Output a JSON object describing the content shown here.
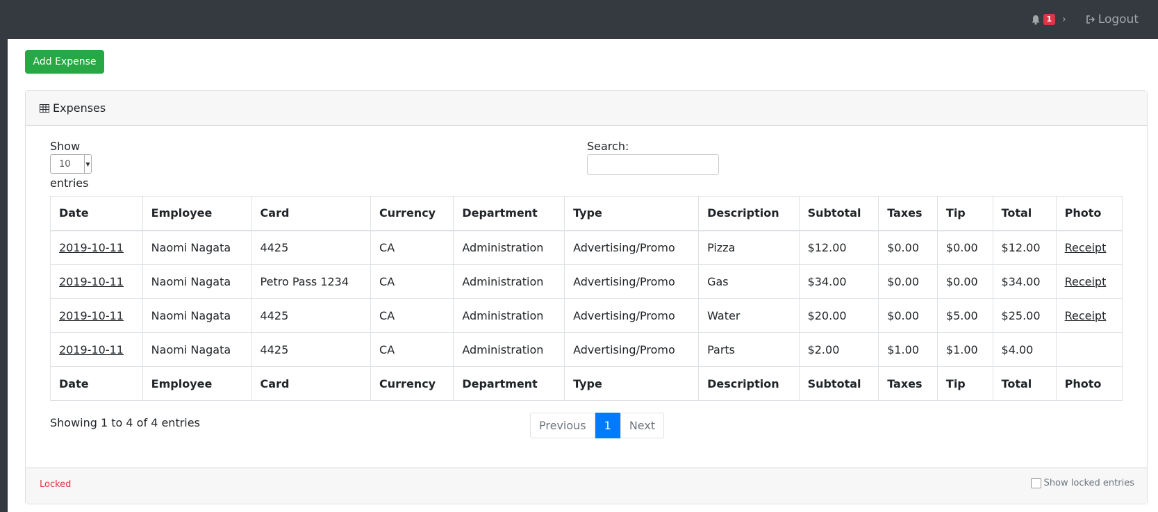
{
  "topbar": {
    "notification_count": "1",
    "logout_label": "Logout"
  },
  "actions": {
    "add_expense_label": "Add Expense"
  },
  "card": {
    "title": "Expenses",
    "length_show_label": "Show",
    "length_value": "10",
    "length_entries_label": "entries",
    "search_label": "Search:",
    "search_value": "",
    "columns": [
      "Date",
      "Employee",
      "Card",
      "Currency",
      "Department",
      "Type",
      "Description",
      "Subtotal",
      "Taxes",
      "Tip",
      "Total",
      "Photo"
    ],
    "rows": [
      [
        "2019-10-11",
        "Naomi Nagata",
        "4425",
        "CA",
        "Administration",
        "Advertising/Promo",
        "Pizza",
        "$12.00",
        "$0.00",
        "$0.00",
        "$12.00",
        "Receipt"
      ],
      [
        "2019-10-11",
        "Naomi Nagata",
        "Petro Pass 1234",
        "CA",
        "Administration",
        "Advertising/Promo",
        "Gas",
        "$34.00",
        "$0.00",
        "$0.00",
        "$34.00",
        "Receipt"
      ],
      [
        "2019-10-11",
        "Naomi Nagata",
        "4425",
        "CA",
        "Administration",
        "Advertising/Promo",
        "Water",
        "$20.00",
        "$0.00",
        "$5.00",
        "$25.00",
        "Receipt"
      ],
      [
        "2019-10-11",
        "Naomi Nagata",
        "4425",
        "CA",
        "Administration",
        "Advertising/Promo",
        "Parts",
        "$2.00",
        "$1.00",
        "$1.00",
        "$4.00",
        ""
      ]
    ],
    "info": "Showing 1 to 4 of 4 entries",
    "pager": {
      "previous": "Previous",
      "current": "1",
      "next": "Next"
    },
    "footer": {
      "locked_label": "Locked",
      "show_locked_label": "Show locked entries"
    }
  },
  "colors": {
    "topbar": "#343a40",
    "primary": "#007bff",
    "success": "#28a745",
    "danger": "#dc3545"
  }
}
